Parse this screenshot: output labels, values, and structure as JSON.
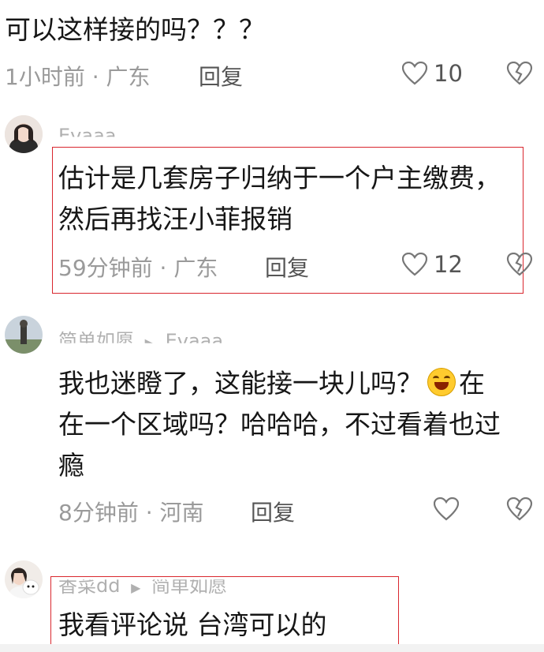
{
  "comment0": {
    "text": "可以这样接的吗？？？",
    "meta": "1小时前 · 广东",
    "reply": "回复",
    "likes": "10"
  },
  "comment1": {
    "username": "Evaaa",
    "lines": [
      "估计是几套房子归纳于一个户主缴费，",
      "然后再找汪小菲报销"
    ],
    "meta": "59分钟前 · 广东",
    "reply": "回复",
    "likes": "12"
  },
  "comment2": {
    "username": "简单如愿",
    "reply_to": "Evaaa",
    "line1_pre": "我也迷瞪了，这能接一块儿吗？",
    "emoji": "laughing-crying-emoji",
    "line1_post": "在",
    "line2": "在一个区域吗？哈哈哈，不过看着也过",
    "line3": "瘾",
    "meta": "8分钟前 · 河南",
    "reply": "回复"
  },
  "comment3": {
    "username": "香菜dd",
    "reply_to": "简单如愿",
    "text": "我看评论说 台湾可以的"
  },
  "colors": {
    "highlight": "#d9272e",
    "meta": "#9a9a9a",
    "text": "#161616"
  }
}
